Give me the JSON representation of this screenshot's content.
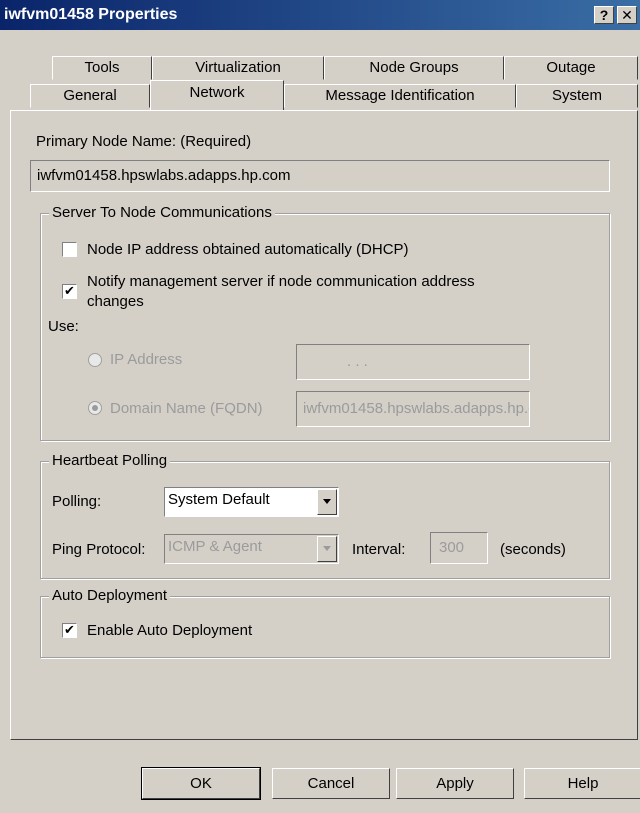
{
  "window": {
    "title": "iwfvm01458 Properties",
    "help_glyph": "?",
    "close_glyph": "✕"
  },
  "tabs_back": [
    "Tools",
    "Virtualization",
    "Node Groups",
    "Outage"
  ],
  "tabs_front": [
    "General",
    "Network",
    "Message Identification",
    "System"
  ],
  "active_tab": "Network",
  "primary_node": {
    "label": "Primary Node Name: (Required)",
    "value": "iwfvm01458.hpswlabs.adapps.hp.com"
  },
  "server_comm": {
    "legend": "Server To Node Communications",
    "dhcp_label": "Node IP address obtained automatically (DHCP)",
    "dhcp_checked": false,
    "notify_label_1": "Notify management server if node communication address",
    "notify_label_2": "changes",
    "notify_checked": true,
    "use_label": "Use:",
    "ip_label": "IP Address",
    "ip_value": ".        .        .",
    "fqdn_label": "Domain Name (FQDN)",
    "fqdn_value": "iwfvm01458.hpswlabs.adapps.hp.com"
  },
  "heartbeat": {
    "legend": "Heartbeat Polling",
    "polling_label": "Polling:",
    "polling_value": "System Default",
    "ping_label": "Ping Protocol:",
    "ping_value": "ICMP & Agent",
    "interval_label": "Interval:",
    "interval_value": "300",
    "seconds_label": "(seconds)"
  },
  "auto_deploy": {
    "legend": "Auto Deployment",
    "enable_label": "Enable Auto Deployment",
    "enable_checked": true
  },
  "buttons": {
    "ok": "OK",
    "cancel": "Cancel",
    "apply": "Apply",
    "help": "Help"
  },
  "glyphs": {
    "check": "✔"
  }
}
